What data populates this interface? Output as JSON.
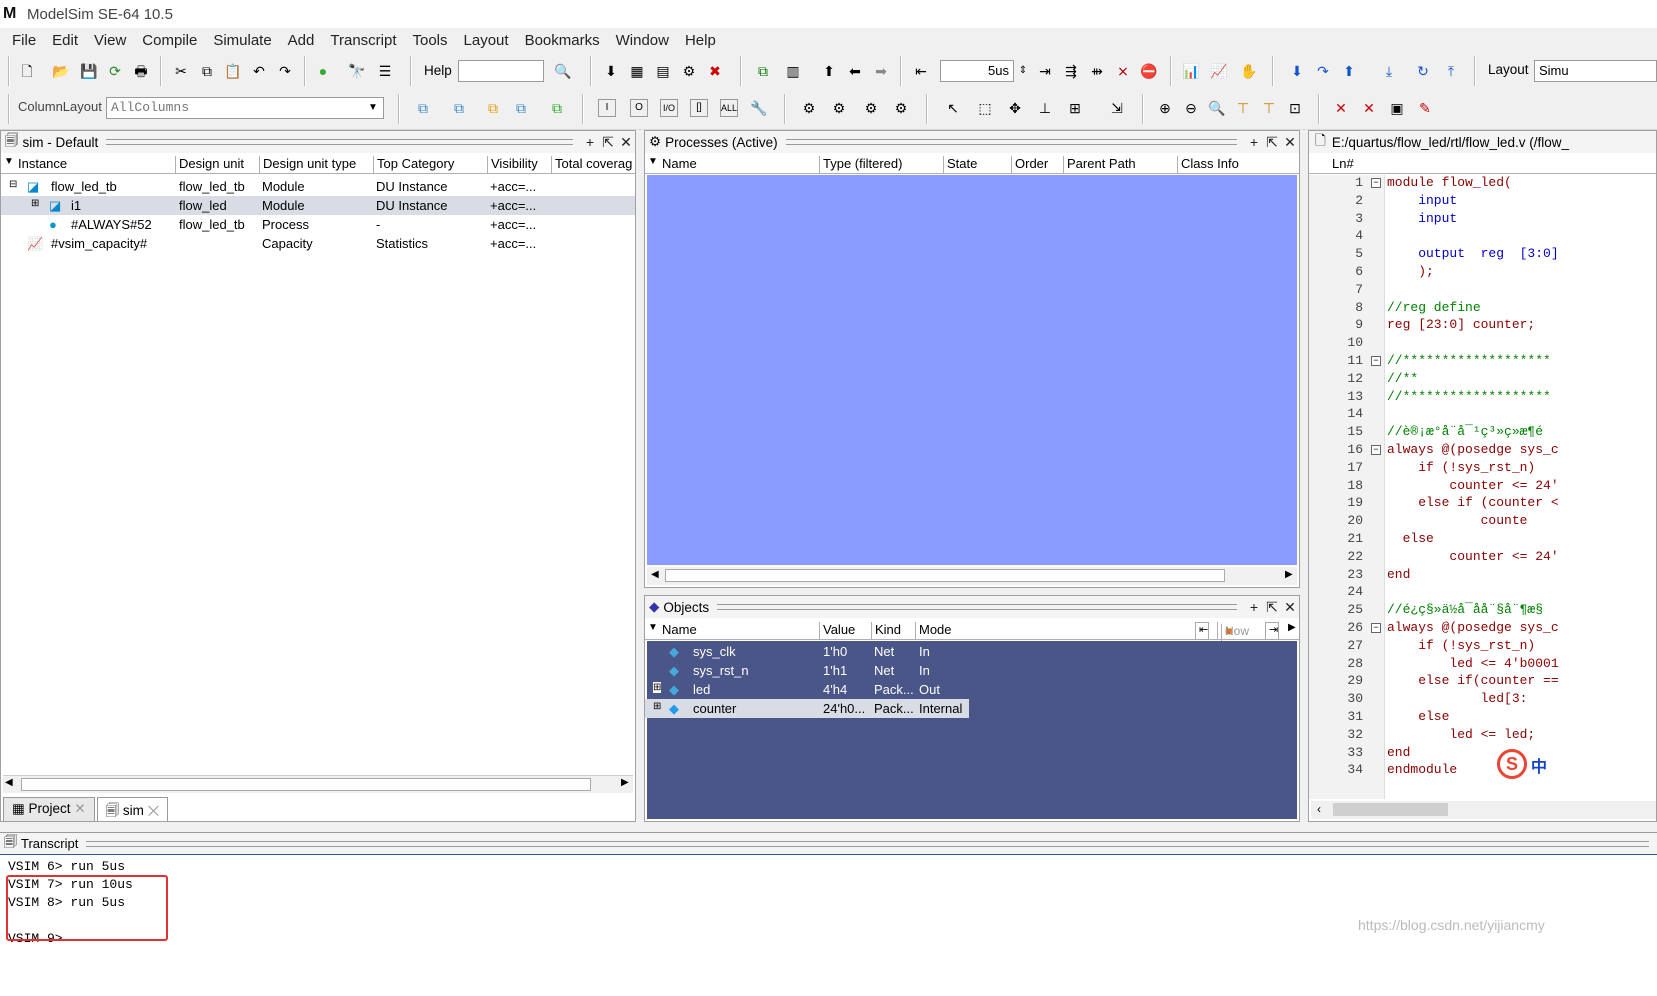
{
  "app": {
    "title": "ModelSim SE-64 10.5",
    "logo": "M"
  },
  "menu": [
    "File",
    "Edit",
    "View",
    "Compile",
    "Simulate",
    "Add",
    "Transcript",
    "Tools",
    "Layout",
    "Bookmarks",
    "Window",
    "Help"
  ],
  "toolbar": {
    "help_label": "Help",
    "help_value": "",
    "run_length": "5us",
    "layout_label": "Layout",
    "layout_value": "Simu",
    "column_layout_label": "ColumnLayout",
    "column_layout_value": "AllColumns"
  },
  "sim_panel": {
    "title": "sim - Default",
    "columns": [
      "Instance",
      "Design unit",
      "Design unit type",
      "Top Category",
      "Visibility",
      "Total coverag"
    ],
    "rows": [
      {
        "instance": "flow_led_tb",
        "unit": "flow_led_tb",
        "type": "Module",
        "category": "DU Instance",
        "visibility": "+acc=..."
      },
      {
        "instance": "i1",
        "unit": "flow_led",
        "type": "Module",
        "category": "DU Instance",
        "visibility": "+acc=..."
      },
      {
        "instance": "#ALWAYS#52",
        "unit": "flow_led_tb",
        "type": "Process",
        "category": "-",
        "visibility": "+acc=..."
      },
      {
        "instance": "#vsim_capacity#",
        "unit": "",
        "type": "Capacity",
        "category": "Statistics",
        "visibility": "+acc=..."
      }
    ],
    "tabs": [
      "Project",
      "sim"
    ]
  },
  "processes_panel": {
    "title": "Processes (Active)",
    "columns": [
      "Name",
      "Type (filtered)",
      "State",
      "Order",
      "Parent Path",
      "Class Info"
    ]
  },
  "objects_panel": {
    "title": "Objects",
    "columns": [
      "Name",
      "Value",
      "Kind",
      "Mode"
    ],
    "now_label": "Now",
    "rows": [
      {
        "name": "sys_clk",
        "value": "1'h0",
        "kind": "Net",
        "mode": "In"
      },
      {
        "name": "sys_rst_n",
        "value": "1'h1",
        "kind": "Net",
        "mode": "In"
      },
      {
        "name": "led",
        "value": "4'h4",
        "kind": "Pack...",
        "mode": "Out"
      },
      {
        "name": "counter",
        "value": "24'h0...",
        "kind": "Pack...",
        "mode": "Internal"
      }
    ]
  },
  "source_panel": {
    "title": "E:/quartus/flow_led/rtl/flow_led.v (/flow_",
    "ln_header": "Ln#",
    "lines": [
      "module flow_led(",
      "    input",
      "    input",
      "",
      "    output  reg  [3:0]",
      "    );",
      "",
      "//reg define",
      "reg [23:0] counter;",
      "",
      "//*******************",
      "//**",
      "//*******************",
      "",
      "//è®¡æ°å¨å¯¹ç³»ç»æ¶é",
      "always @(posedge sys_c",
      "    if (!sys_rst_n)",
      "        counter <= 24'",
      "    else if (counter <",
      "            counte",
      "  else",
      "        counter <= 24'",
      "end",
      "",
      "//é¿ç§»ä½å¯å­å¨§å¨¶æ§",
      "always @(posedge sys_c",
      "    if (!sys_rst_n)",
      "        led <= 4'b0001",
      "    else if(counter ==",
      "            led[3:",
      "    else",
      "        led <= led;",
      "end",
      "endmodule"
    ],
    "ime_label": "中"
  },
  "transcript": {
    "title": "Transcript",
    "lines": [
      "VSIM 6> run 5us",
      "VSIM 7> run 10us",
      "VSIM 8> run 5us",
      "",
      "VSIM 9>"
    ],
    "watermark": "https://blog.csdn.net/yijiancmy"
  }
}
